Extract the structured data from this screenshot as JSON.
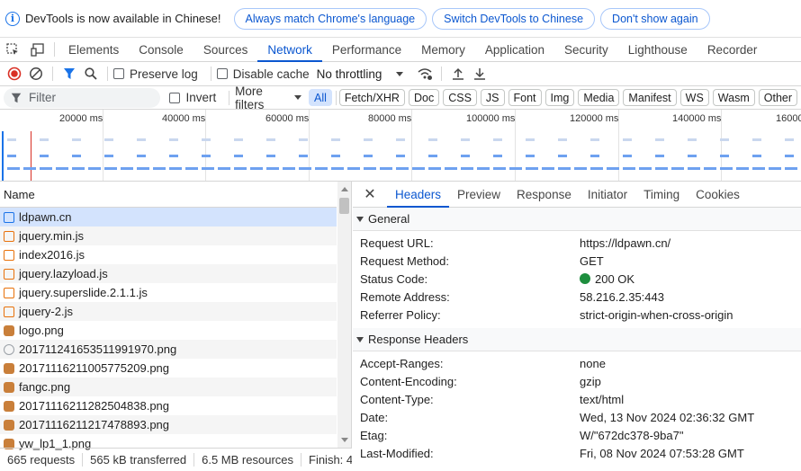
{
  "infobar": {
    "message": "DevTools is now available in Chinese!",
    "buttons": [
      "Always match Chrome's language",
      "Switch DevTools to Chinese",
      "Don't show again"
    ]
  },
  "main_tabs": [
    "Elements",
    "Console",
    "Sources",
    "Network",
    "Performance",
    "Memory",
    "Application",
    "Security",
    "Lighthouse",
    "Recorder"
  ],
  "active_main_tab": "Network",
  "toolbar": {
    "preserve_log": "Preserve log",
    "disable_cache": "Disable cache",
    "throttling": "No throttling"
  },
  "filterbar": {
    "placeholder": "Filter",
    "invert": "Invert",
    "more_filters": "More filters",
    "chips": [
      "All",
      "Fetch/XHR",
      "Doc",
      "CSS",
      "JS",
      "Font",
      "Img",
      "Media",
      "Manifest",
      "WS",
      "Wasm",
      "Other"
    ],
    "active_chip": "All"
  },
  "overview": {
    "ticks": [
      "20000 ms",
      "40000 ms",
      "60000 ms",
      "80000 ms",
      "100000 ms",
      "120000 ms",
      "140000 ms",
      "16000"
    ]
  },
  "request_list": {
    "header": "Name",
    "rows": [
      {
        "name": "ldpawn.cn",
        "type": "doc"
      },
      {
        "name": "jquery.min.js",
        "type": "js"
      },
      {
        "name": "index2016.js",
        "type": "js"
      },
      {
        "name": "jquery.lazyload.js",
        "type": "js"
      },
      {
        "name": "jquery.superslide.2.1.1.js",
        "type": "js"
      },
      {
        "name": "jquery-2.js",
        "type": "js"
      },
      {
        "name": "logo.png",
        "type": "img2"
      },
      {
        "name": "201711241653511991970.png",
        "type": "img"
      },
      {
        "name": "20171116211005775209.png",
        "type": "img2"
      },
      {
        "name": "fangc.png",
        "type": "img2"
      },
      {
        "name": "20171116211282504838.png",
        "type": "img2"
      },
      {
        "name": "20171116211217478893.png",
        "type": "img2"
      },
      {
        "name": "yw_lp1_1.png",
        "type": "img2"
      }
    ]
  },
  "status": {
    "requests": "665 requests",
    "transferred": "565 kB transferred",
    "resources": "6.5 MB resources",
    "finish": "Finish: 4"
  },
  "detail_tabs": [
    "Headers",
    "Preview",
    "Response",
    "Initiator",
    "Timing",
    "Cookies"
  ],
  "active_detail_tab": "Headers",
  "general": {
    "title": "General",
    "rows": [
      {
        "k": "Request URL:",
        "v": "https://ldpawn.cn/"
      },
      {
        "k": "Request Method:",
        "v": "GET"
      },
      {
        "k": "Status Code:",
        "v": "200 OK"
      },
      {
        "k": "Remote Address:",
        "v": "58.216.2.35:443"
      },
      {
        "k": "Referrer Policy:",
        "v": "strict-origin-when-cross-origin"
      }
    ]
  },
  "response_headers": {
    "title": "Response Headers",
    "rows": [
      {
        "k": "Accept-Ranges:",
        "v": "none"
      },
      {
        "k": "Content-Encoding:",
        "v": "gzip"
      },
      {
        "k": "Content-Type:",
        "v": "text/html"
      },
      {
        "k": "Date:",
        "v": "Wed, 13 Nov 2024 02:36:32 GMT"
      },
      {
        "k": "Etag:",
        "v": "W/\"672dc378-9ba7\""
      },
      {
        "k": "Last-Modified:",
        "v": "Fri, 08 Nov 2024 07:53:28 GMT"
      }
    ]
  },
  "colors": {
    "accent": "#0b57d0",
    "selected": "#d3e3fd",
    "record": "#d93025",
    "status_ok": "#1e8e3e"
  }
}
